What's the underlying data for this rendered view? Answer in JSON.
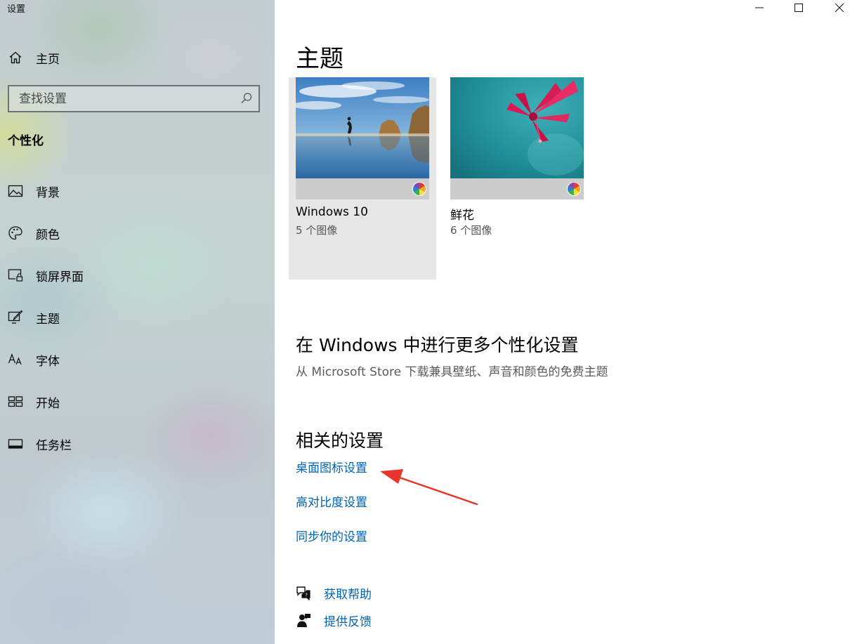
{
  "window": {
    "title": "设置",
    "controls": [
      "minimize",
      "maximize",
      "close"
    ]
  },
  "sidebar": {
    "home_label": "主页",
    "search": {
      "placeholder": "查找设置",
      "icon": "search-icon"
    },
    "section_title": "个性化",
    "items": [
      {
        "label": "背景",
        "icon": "picture-icon"
      },
      {
        "label": "颜色",
        "icon": "palette-icon"
      },
      {
        "label": "锁屏界面",
        "icon": "lock-screen-icon"
      },
      {
        "label": "主题",
        "icon": "theme-brush-icon"
      },
      {
        "label": "字体",
        "icon": "font-icon"
      },
      {
        "label": "开始",
        "icon": "start-icon"
      },
      {
        "label": "任务栏",
        "icon": "taskbar-icon"
      }
    ]
  },
  "main": {
    "title": "主题",
    "themes": [
      {
        "name": "Windows 10",
        "count": "5 个图像",
        "selected": true
      },
      {
        "name": "鲜花",
        "count": "6 个图像",
        "selected": false
      }
    ],
    "more": {
      "title": "在 Windows 中进行更多个性化设置",
      "description": "从 Microsoft Store 下载兼具壁纸、声音和颜色的免费主题"
    },
    "related": {
      "title": "相关的设置",
      "links": [
        "桌面图标设置",
        "高对比度设置",
        "同步你的设置"
      ]
    },
    "help": [
      {
        "label": "获取帮助",
        "icon": "help-chat-icon"
      },
      {
        "label": "提供反馈",
        "icon": "feedback-icon"
      }
    ]
  },
  "colors": {
    "link": "#0063b1",
    "annotation_arrow": "#e8352b",
    "selected_card": "#e6e6e6"
  }
}
